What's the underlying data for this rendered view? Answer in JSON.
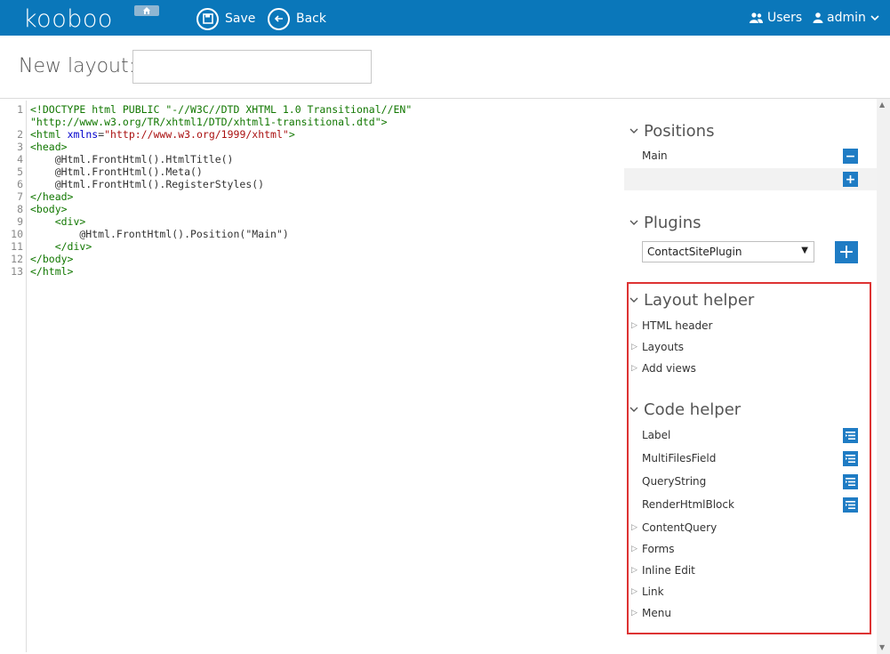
{
  "header": {
    "logo": "kooboo",
    "save_label": "Save",
    "back_label": "Back",
    "users_label": "Users",
    "admin_label": "admin",
    "brand_color": "#0a77ba"
  },
  "title_row": {
    "label": "New layout:",
    "input_value": ""
  },
  "editor": {
    "lines": [
      {
        "n": "1",
        "html": "<span class=\"tag\">&lt;!DOCTYPE html PUBLIC \"-//W3C//DTD XHTML 1.0 Transitional//EN\"</span>"
      },
      {
        "n": "",
        "html": "<span class=\"tag\">\"http://www.w3.org/TR/xhtml1/DTD/xhtml1-transitional.dtd\"&gt;</span>"
      },
      {
        "n": "2",
        "html": "<span class=\"tag\">&lt;html</span> <span class=\"attr\">xmlns</span>=<span class=\"str\">\"http://www.w3.org/1999/xhtml\"</span><span class=\"tag\">&gt;</span>"
      },
      {
        "n": "3",
        "html": "<span class=\"tag\">&lt;head&gt;</span>"
      },
      {
        "n": "4",
        "html": "    @Html.FrontHtml().HtmlTitle()"
      },
      {
        "n": "5",
        "html": "    @Html.FrontHtml().Meta()"
      },
      {
        "n": "6",
        "html": "    @Html.FrontHtml().RegisterStyles()"
      },
      {
        "n": "7",
        "html": "<span class=\"tag\">&lt;/head&gt;</span>"
      },
      {
        "n": "8",
        "html": "<span class=\"tag\">&lt;body&gt;</span>"
      },
      {
        "n": "9",
        "html": "    <span class=\"tag\">&lt;div&gt;</span>"
      },
      {
        "n": "10",
        "html": "        @Html.FrontHtml().Position(\"Main\")"
      },
      {
        "n": "11",
        "html": "    <span class=\"tag\">&lt;/div&gt;</span>"
      },
      {
        "n": "12",
        "html": "<span class=\"tag\">&lt;/body&gt;</span>"
      },
      {
        "n": "13",
        "html": "<span class=\"tag\">&lt;/html&gt;</span>"
      }
    ]
  },
  "panel": {
    "positions": {
      "title": "Positions",
      "items": [
        "Main"
      ]
    },
    "plugins": {
      "title": "Plugins",
      "selected": "ContactSitePlugin"
    },
    "layout_helper": {
      "title": "Layout helper",
      "items": [
        "HTML header",
        "Layouts",
        "Add views"
      ]
    },
    "code_helper": {
      "title": "Code helper",
      "leaf_items": [
        "Label",
        "MultiFilesField",
        "QueryString",
        "RenderHtmlBlock"
      ],
      "group_items": [
        "ContentQuery",
        "Forms",
        "Inline Edit",
        "Link",
        "Menu"
      ]
    },
    "highlight_color": "#dd3333"
  }
}
